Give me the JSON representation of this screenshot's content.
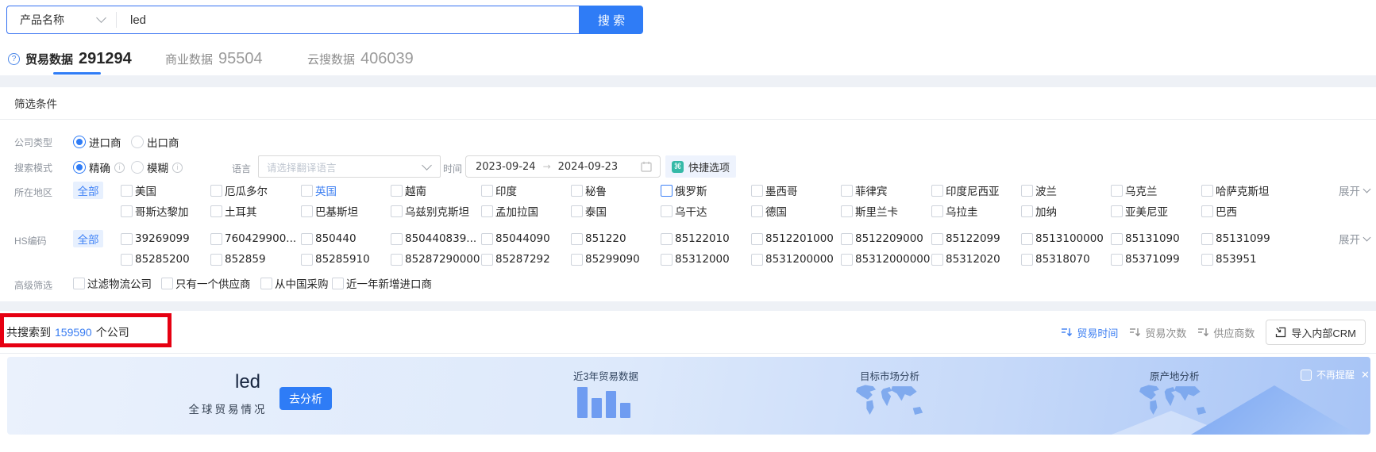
{
  "search": {
    "category": "产品名称",
    "query": "led",
    "button": "搜 索"
  },
  "tabs": [
    {
      "label": "贸易数据",
      "count": "291294",
      "active": true
    },
    {
      "label": "商业数据",
      "count": "95504",
      "active": false
    },
    {
      "label": "云搜数据",
      "count": "406039",
      "active": false
    }
  ],
  "filter": {
    "title": "筛选条件",
    "company_type": {
      "label": "公司类型",
      "options": [
        {
          "t": "进口商",
          "checked": true
        },
        {
          "t": "出口商",
          "checked": false
        }
      ]
    },
    "search_mode": {
      "label": "搜索模式",
      "options": [
        {
          "t": "精确",
          "checked": true
        },
        {
          "t": "模糊",
          "checked": false
        }
      ],
      "language_label": "语言",
      "language_placeholder": "请选择翻译语言",
      "time_label": "时间",
      "date_start": "2023-09-24",
      "date_end": "2024-09-23",
      "quick_label": "快捷选项"
    },
    "region": {
      "label": "所在地区",
      "all": "全部",
      "expand": "展开",
      "row1": [
        {
          "t": "美国"
        },
        {
          "t": "厄瓜多尔"
        },
        {
          "t": "英国",
          "blue": true
        },
        {
          "t": "越南"
        },
        {
          "t": "印度"
        },
        {
          "t": "秘鲁"
        },
        {
          "t": "俄罗斯",
          "cbBlue": true
        },
        {
          "t": "墨西哥"
        },
        {
          "t": "菲律宾"
        },
        {
          "t": "印度尼西亚"
        },
        {
          "t": "波兰"
        },
        {
          "t": "乌克兰"
        },
        {
          "t": "哈萨克斯坦"
        }
      ],
      "row2": [
        {
          "t": "哥斯达黎加"
        },
        {
          "t": "土耳其"
        },
        {
          "t": "巴基斯坦"
        },
        {
          "t": "乌兹别克斯坦"
        },
        {
          "t": "孟加拉国"
        },
        {
          "t": "泰国"
        },
        {
          "t": "乌干达"
        },
        {
          "t": "德国"
        },
        {
          "t": "斯里兰卡"
        },
        {
          "t": "乌拉圭"
        },
        {
          "t": "加纳"
        },
        {
          "t": "亚美尼亚"
        },
        {
          "t": "巴西"
        }
      ]
    },
    "hs": {
      "label": "HS编码",
      "all": "全部",
      "expand": "展开",
      "row1": [
        {
          "t": "39269099"
        },
        {
          "t": "760429900..."
        },
        {
          "t": "850440"
        },
        {
          "t": "850440839..."
        },
        {
          "t": "85044090"
        },
        {
          "t": "851220"
        },
        {
          "t": "85122010"
        },
        {
          "t": "8512201000"
        },
        {
          "t": "8512209000"
        },
        {
          "t": "85122099"
        },
        {
          "t": "8513100000"
        },
        {
          "t": "85131090"
        },
        {
          "t": "85131099"
        }
      ],
      "row2": [
        {
          "t": "85285200"
        },
        {
          "t": "852859"
        },
        {
          "t": "85285910"
        },
        {
          "t": "85287290000"
        },
        {
          "t": "85287292"
        },
        {
          "t": "85299090"
        },
        {
          "t": "85312000"
        },
        {
          "t": "8531200000"
        },
        {
          "t": "85312000000"
        },
        {
          "t": "85312020"
        },
        {
          "t": "85318070"
        },
        {
          "t": "85371099"
        },
        {
          "t": "853951"
        }
      ]
    },
    "advanced": {
      "label": "高级筛选",
      "options": [
        {
          "t": "过滤物流公司"
        },
        {
          "t": "只有一个供应商"
        },
        {
          "t": "从中国采购"
        },
        {
          "t": "近一年新增进口商"
        }
      ]
    }
  },
  "results": {
    "prefix": "共搜索到",
    "count": "159590",
    "suffix": "个公司",
    "sorts": [
      {
        "t": "贸易时间",
        "active": true
      },
      {
        "t": "贸易次数",
        "active": false
      },
      {
        "t": "供应商数",
        "active": false
      }
    ],
    "crm_button": "导入内部CRM"
  },
  "banner": {
    "keyword": "led",
    "subtitle": "全球贸易情况",
    "analyze_button": "去分析",
    "section1": "近3年贸易数据",
    "section2": "目标市场分析",
    "section3": "原产地分析",
    "dismiss": "不再提醒",
    "chart_bars": [
      39,
      25,
      34,
      19
    ]
  },
  "colors": {
    "accent": "#2f7cf6",
    "link": "#3b7ef2",
    "annotation_red": "#e60012",
    "quick_icon_teal": "#35b9a7"
  }
}
